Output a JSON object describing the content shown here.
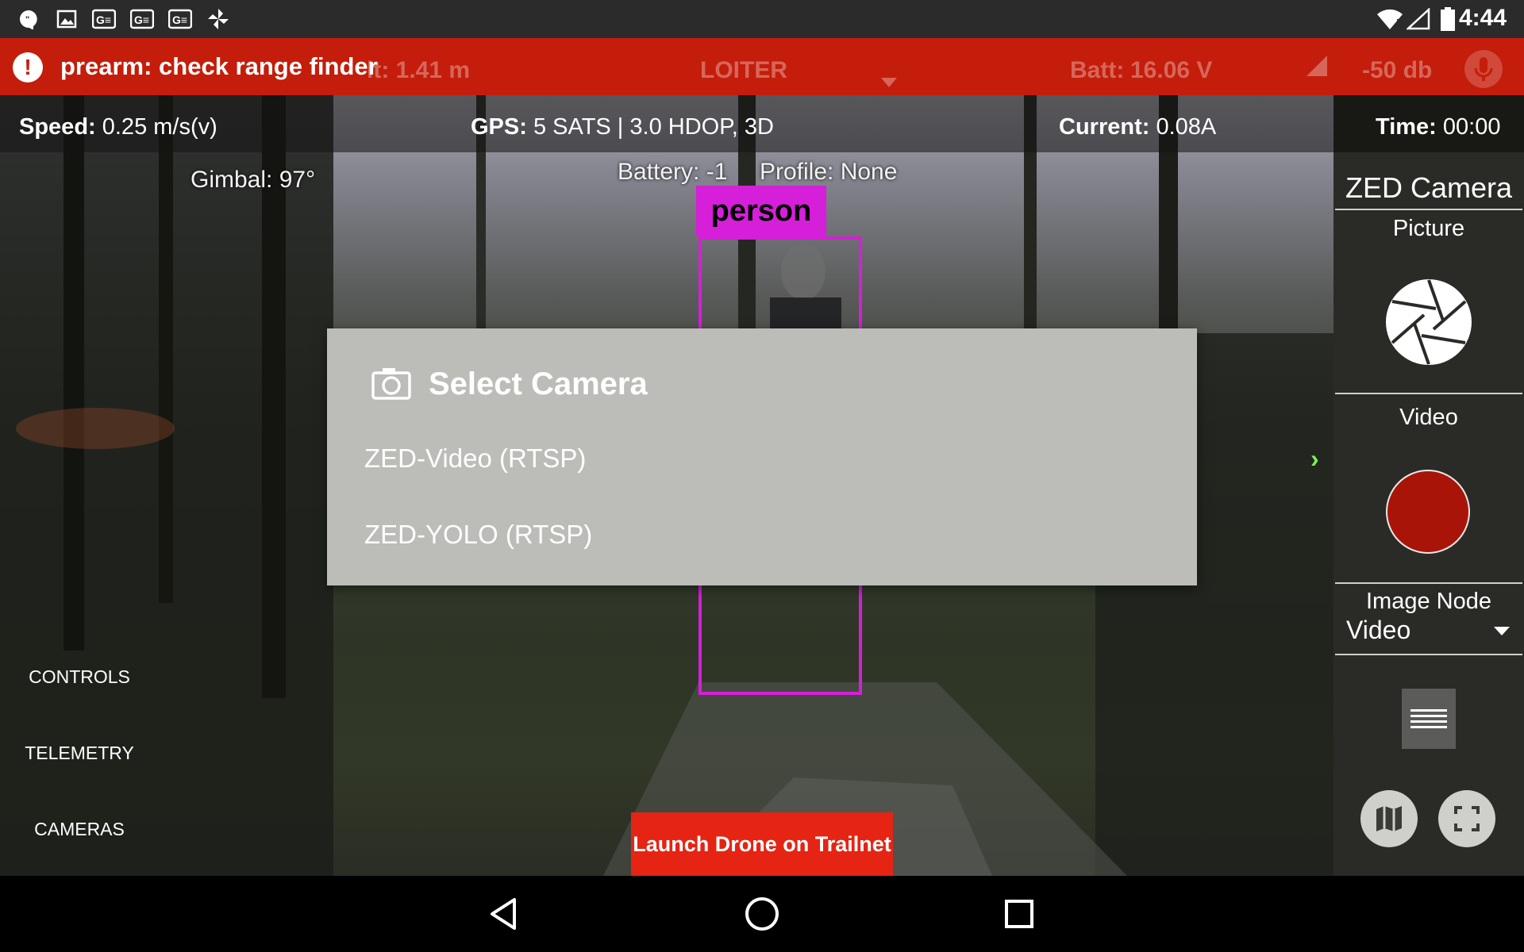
{
  "status_bar": {
    "time": "4:44",
    "left_icons": [
      "chat-bubble-icon",
      "image-icon",
      "google-translate-icon",
      "google-translate-icon",
      "google-translate-icon",
      "pinwheel-icon"
    ],
    "right_icons": [
      "wifi-icon",
      "cell-signal-icon",
      "battery-icon"
    ]
  },
  "alert": {
    "message": "prearm: check range finder",
    "icon": "alert-circle-icon",
    "background_color": "#c41d0b",
    "ghost": {
      "altitude": "lt: 1.41 m",
      "mode": "LOITER",
      "battery_label": "Batt:",
      "battery_value": "16.06 V",
      "signal": "-50 db"
    }
  },
  "telemetry": {
    "speed_label": "Speed:",
    "speed_value": "0.25 m/s(v)",
    "gps_label": "GPS:",
    "gps_value": "5 SATS | 3.0 HDOP, 3D",
    "current_label": "Current:",
    "current_value": "0.08A",
    "time_label": "Time:",
    "time_value": "00:00"
  },
  "overlay": {
    "gimbal": "Gimbal: 97°",
    "battery": "Battery: -1",
    "profile": "Profile: None"
  },
  "detection": {
    "label": "person",
    "color": "#d51fd9"
  },
  "dialog": {
    "title": "Select Camera",
    "title_icon": "camera-icon",
    "options": [
      "ZED-Video (RTSP)",
      "ZED-YOLO (RTSP)"
    ]
  },
  "left_nav": {
    "items": [
      "CONTROLS",
      "TELEMETRY",
      "CAMERAS"
    ]
  },
  "right_panel": {
    "title": "ZED Camera",
    "picture_label": "Picture",
    "video_label": "Video",
    "image_node_label": "Image Node",
    "image_node_value": "Video",
    "record_color": "#a81508"
  },
  "launch_button": {
    "label": "Launch Drone on Trailnet",
    "color": "#e52414"
  },
  "nav_bar": {
    "buttons": [
      "back-icon",
      "home-icon",
      "recents-icon"
    ]
  }
}
